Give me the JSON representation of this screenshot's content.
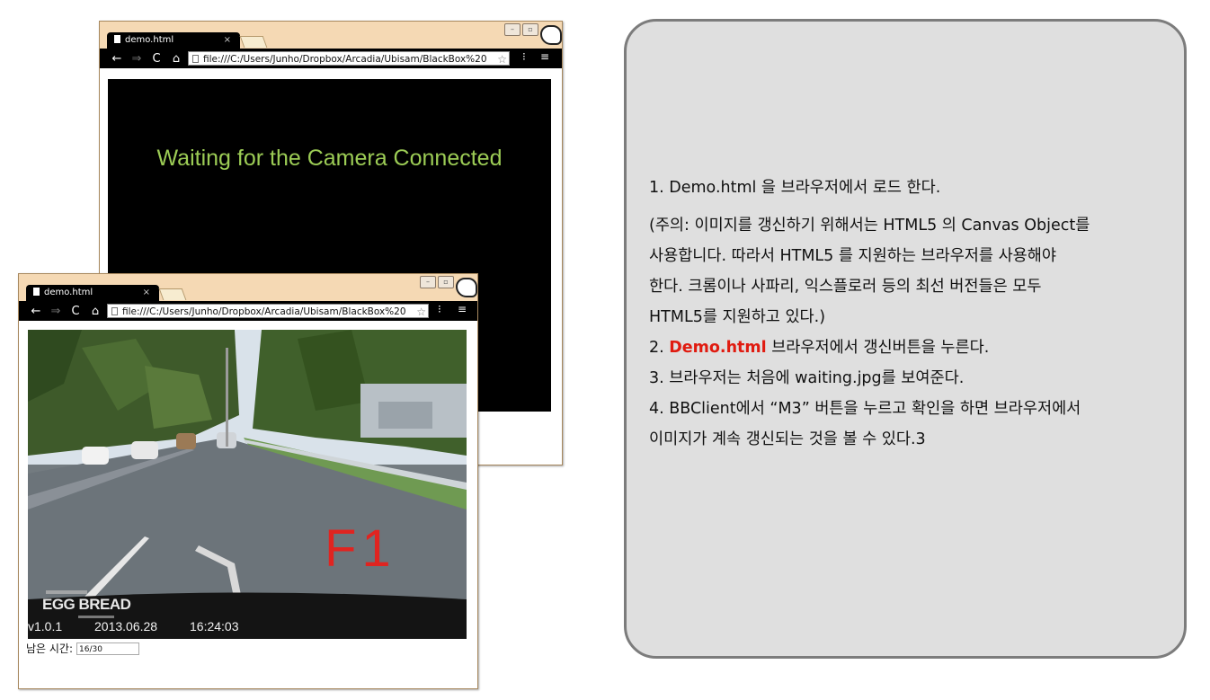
{
  "window_back": {
    "tab_title": "demo.html",
    "tab_close": "×",
    "url": "file:///C:/Users/Junho/Dropbox/Arcadia/Ubisam/BlackBox%20",
    "message": "Waiting for the Camera Connected"
  },
  "window_front": {
    "tab_title": "demo.html",
    "tab_close": "×",
    "url": "file:///C:/Users/Junho/Dropbox/Arcadia/Ubisam/BlackBox%20",
    "overlay_text": "F1",
    "brand": "EGG BREAD",
    "version": "v1.0.1",
    "date": "2013.06.28",
    "time": "16:24:03",
    "remaining_label": "남은 시간:",
    "remaining_value": "16/30"
  },
  "toolbar": {
    "back": "←",
    "forward": "⇒",
    "reload": "C",
    "home": "⌂",
    "star": "☆",
    "menu": "≡"
  },
  "instructions": {
    "step1": "1.    Demo.html 을 브라우저에서 로드 한다.",
    "note_line1": "(주의: 이미지를 갱신하기 위해서는 HTML5 의 Canvas Object를",
    "note_line2": "사용합니다. 따라서 HTML5 를 지원하는 브라우저를 사용해야",
    "note_line3": "한다. 크롬이나 사파리, 익스플로러 등의 최선 버전들은 모두",
    "note_line4": "HTML5를 지원하고 있다.)",
    "step2_prefix": "2. ",
    "step2_highlight": "Demo.html",
    "step2_suffix": " 브라우저에서 갱신버튼을 누른다.",
    "step3": "3. 브라우저는 처음에 waiting.jpg를 보여준다.",
    "step4_line1": "4. BBClient에서 “M3” 버튼을 누르고 확인을 하면 브라우저에서",
    "step4_line2": "이미지가 계속 갱신되는 것을 볼 수 있다.3"
  },
  "colors": {
    "window_frame": "#f5d9b4",
    "panel_bg": "#dfdfdf",
    "panel_border": "#7c7c7c",
    "waiting_text": "#9ccc55",
    "highlight": "#e01b10",
    "f1_text": "#e02420"
  }
}
